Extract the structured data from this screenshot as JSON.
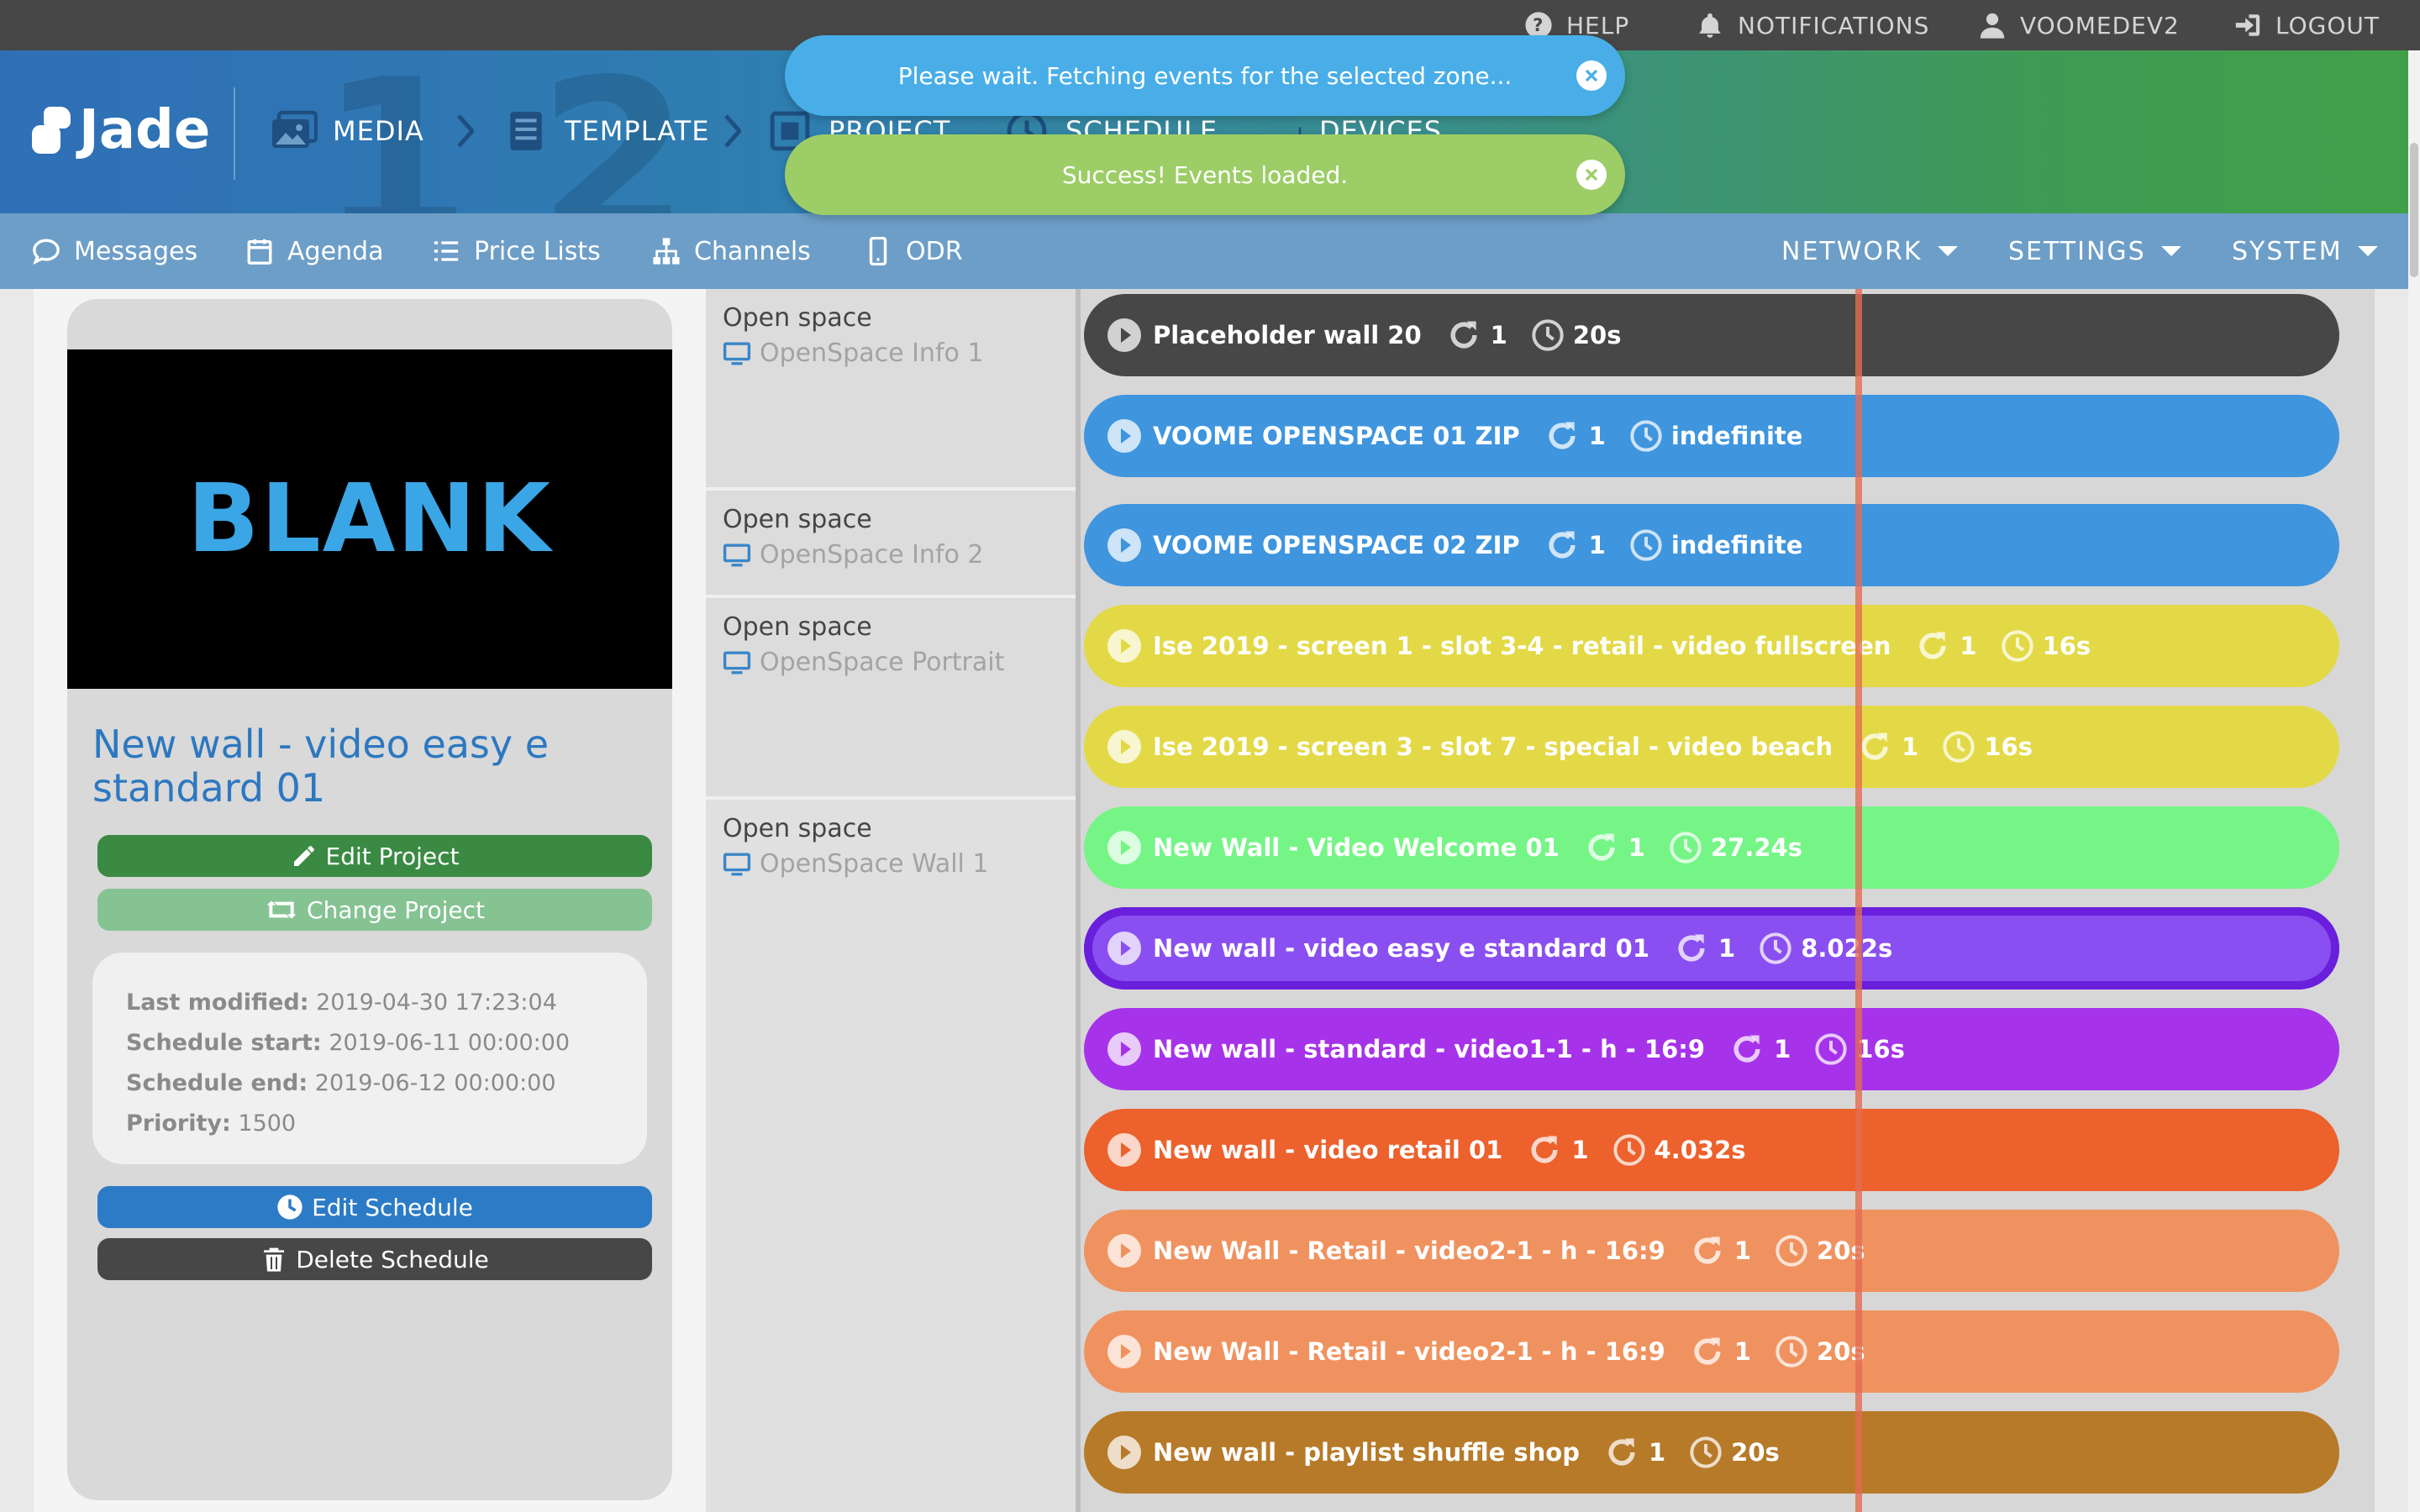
{
  "topbar": {
    "help": "HELP",
    "notifications": "NOTIFICATIONS",
    "user": "VOOMEDEV2",
    "logout": "LOGOUT"
  },
  "header": {
    "logo": "Jade",
    "steps": [
      "MEDIA",
      "TEMPLATE",
      "PROJECT",
      "SCHEDULE",
      "DEVICES"
    ],
    "watermark_numbers": [
      "1",
      "2"
    ]
  },
  "subnav": {
    "left": [
      "Messages",
      "Agenda",
      "Price Lists",
      "Channels",
      "ODR"
    ],
    "right": [
      "NETWORK",
      "SETTINGS",
      "SYSTEM"
    ]
  },
  "toasts": [
    {
      "text": "Please wait. Fetching events for the selected zone...",
      "color": "#49aee8"
    },
    {
      "text": "Success! Events loaded.",
      "color": "#9dcd66"
    }
  ],
  "project": {
    "preview_text": "BLANK",
    "title": "New wall - video easy e standard 01",
    "edit_project": "Edit Project",
    "change_project": "Change Project",
    "info": [
      {
        "label": "Last modified:",
        "value": "2019-04-30 17:23:04"
      },
      {
        "label": "Schedule start:",
        "value": "2019-06-11 00:00:00"
      },
      {
        "label": "Schedule end:",
        "value": "2019-06-12 00:00:00"
      },
      {
        "label": "Priority:",
        "value": "1500"
      }
    ],
    "edit_schedule": "Edit Schedule",
    "delete_schedule": "Delete Schedule"
  },
  "zones": [
    {
      "name": "Open space",
      "device": "OpenSpace Info 1"
    },
    {
      "name": "Open space",
      "device": "OpenSpace Info 2"
    },
    {
      "name": "Open space",
      "device": "OpenSpace Portrait"
    },
    {
      "name": "Open space",
      "device": "OpenSpace Wall 1"
    }
  ],
  "events": [
    {
      "name": "Placeholder wall 20",
      "repeat": "1",
      "duration": "20s",
      "color": "#474747",
      "selected": false
    },
    {
      "name": "VOOME OPENSPACE 01 ZIP",
      "repeat": "1",
      "duration": "indefinite",
      "color": "#3f95de",
      "selected": false
    },
    {
      "name": "VOOME OPENSPACE 02 ZIP",
      "repeat": "1",
      "duration": "indefinite",
      "color": "#3f95de",
      "selected": false
    },
    {
      "name": "Ise 2019 - screen 1 - slot 3-4 - retail - video fullscreen",
      "repeat": "1",
      "duration": "16s",
      "color": "#e3d946",
      "selected": false
    },
    {
      "name": "Ise 2019 - screen 3 - slot 7 - special - video beach",
      "repeat": "1",
      "duration": "16s",
      "color": "#e3d946",
      "selected": false
    },
    {
      "name": "New Wall - Video Welcome 01",
      "repeat": "1",
      "duration": "27.24s",
      "color": "#76f587",
      "selected": false
    },
    {
      "name": "New wall - video easy e standard 01",
      "repeat": "1",
      "duration": "8.022s",
      "color": "#8a4ff0",
      "selected": true
    },
    {
      "name": "New wall - standard - video1-1 - h - 16:9",
      "repeat": "1",
      "duration": "16s",
      "color": "#a633ea",
      "selected": false
    },
    {
      "name": "New wall - video retail 01",
      "repeat": "1",
      "duration": "4.032s",
      "color": "#ec612c",
      "selected": false
    },
    {
      "name": "New Wall - Retail - video2-1 - h - 16:9",
      "repeat": "1",
      "duration": "20s",
      "color": "#f0925f",
      "selected": false
    },
    {
      "name": "New Wall - Retail - video2-1 - h - 16:9",
      "repeat": "1",
      "duration": "20s",
      "color": "#f0925f",
      "selected": false
    },
    {
      "name": "New wall - playlist shuffle shop",
      "repeat": "1",
      "duration": "20s",
      "color": "#b67a29",
      "selected": false
    }
  ]
}
